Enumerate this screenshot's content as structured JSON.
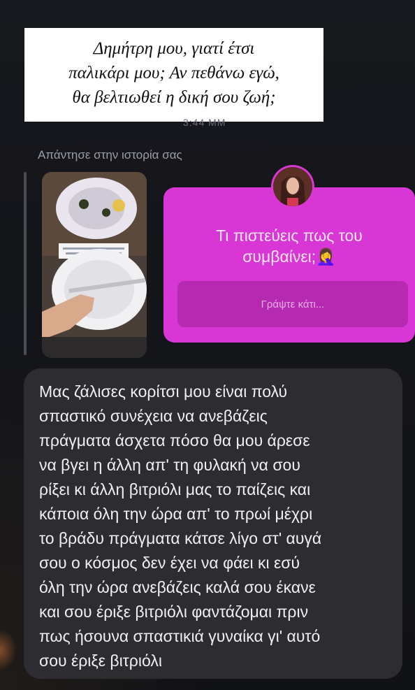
{
  "caption": {
    "lines": [
      "Δημήτρη μου, γιατί έτσι",
      "παλικάρι μου; Αν πεθάνω εγώ,",
      "θα βελτιωθεί η δική σου ζωή;"
    ]
  },
  "timestamp_partial": "3:44 ΜΜ",
  "reply_context": {
    "label": "Απάντησε στην ιστορία σας"
  },
  "question_sticker": {
    "question_lines": [
      "Τι πιστεύεις πως του",
      "συμβαίνει;🤦‍♀️"
    ],
    "input_placeholder": "Γράψτε κάτι...",
    "color": "#d936d6"
  },
  "message": {
    "lines": [
      "Μας ζάλισες κορίτσι μου είναι πολύ",
      "σπαστικό συνέχεια να ανεβάζεις",
      "πράγματα άσχετα πόσο θα μου άρεσε",
      "να βγει η άλλη απ' τη φυλακή να σου",
      "ρίξει κι άλλη βιτριόλι μας το παίζεις και",
      "κάποια όλη την ώρα απ' το πρωί μέχρι",
      "το βράδυ πράγματα κάτσε λίγο στ' αυγά",
      "σου ο κόσμος δεν έχει να φάει κι εσύ",
      "όλη την ώρα ανεβάζεις καλά σου έκανε",
      "και σου έριξε βιτριόλι φαντάζομαι πριν",
      "πως ήσουνα σπαστικιά γυναίκα γι' αυτό",
      "σου έριξε βιτριόλι"
    ],
    "bubble_color": "#2c2c31"
  }
}
